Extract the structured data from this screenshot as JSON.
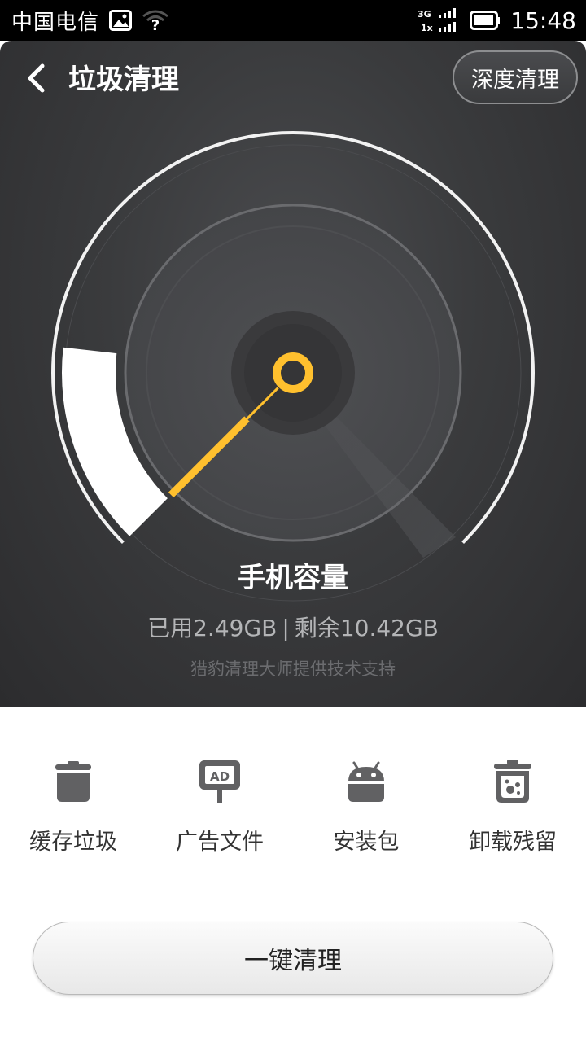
{
  "status_bar": {
    "carrier": "中国电信",
    "network_top": "3G",
    "network_bottom": "1x",
    "time": "15:48",
    "icons": [
      "image-notification-icon",
      "wifi-unknown-icon",
      "signal-icon",
      "battery-icon"
    ]
  },
  "header": {
    "title": "垃圾清理",
    "deep_clean_label": "深度清理"
  },
  "gauge": {
    "used_fraction": 0.19,
    "needle_color": "#ffc02e",
    "fill_color": "#ffffff"
  },
  "capacity": {
    "title": "手机容量",
    "used": "已用2.49GB",
    "separator": "|",
    "remaining": "剩余10.42GB",
    "powered_by": "猎豹清理大师提供技术支持"
  },
  "categories": [
    {
      "label": "缓存垃圾",
      "icon": "trash-can-icon"
    },
    {
      "label": "广告文件",
      "icon": "ad-sign-icon"
    },
    {
      "label": "安装包",
      "icon": "android-icon"
    },
    {
      "label": "卸载残留",
      "icon": "residue-bin-icon"
    }
  ],
  "clean_button": {
    "label": "一键清理"
  }
}
